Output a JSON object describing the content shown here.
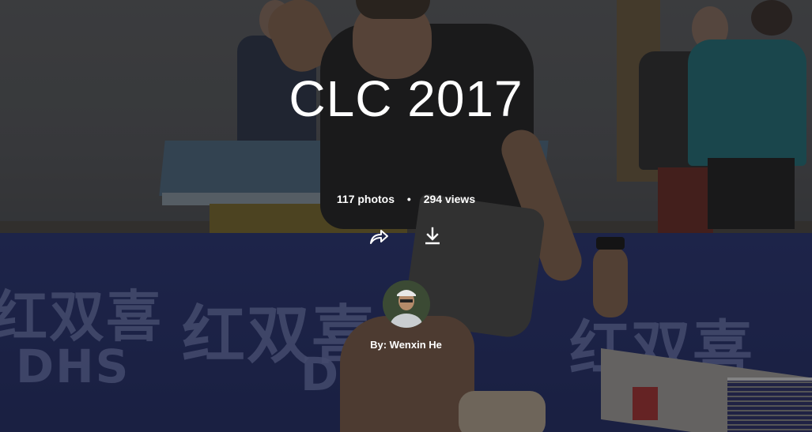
{
  "album": {
    "title": "CLC 2017",
    "photos": "117 photos",
    "separator": "•",
    "views": "294 views",
    "byline": "By: Wenxin He"
  },
  "actions": {
    "share_icon": "share-icon",
    "download_icon": "download-icon"
  },
  "banner": {
    "brand_cn": "红双喜",
    "brand_en": "DHS"
  },
  "colors": {
    "banner": "#263274",
    "text": "#ffffff"
  }
}
